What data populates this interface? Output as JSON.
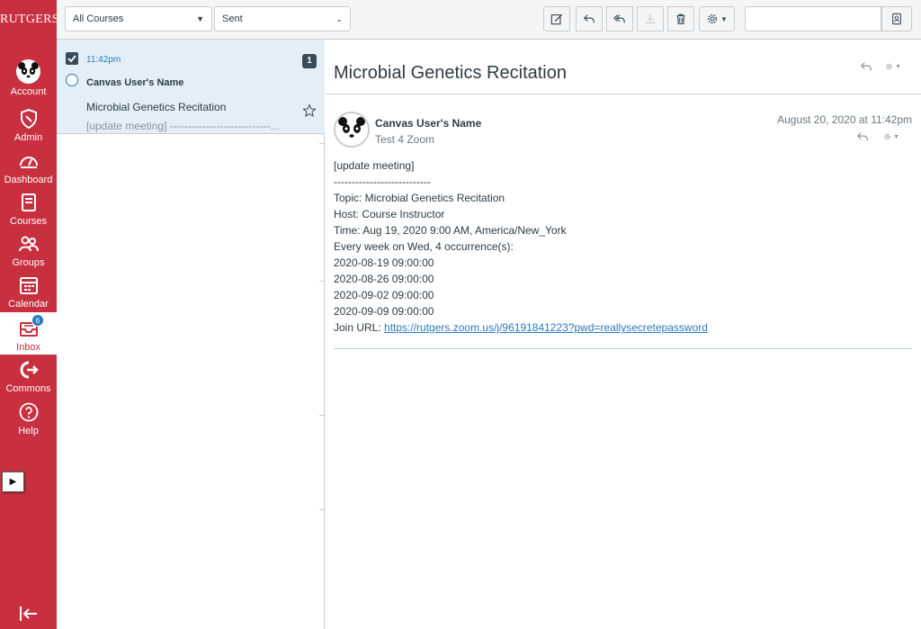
{
  "nav": {
    "logo": "RUTGERS",
    "items": [
      {
        "label": "Account",
        "icon": "account-avatar"
      },
      {
        "label": "Admin",
        "icon": "shield-icon"
      },
      {
        "label": "Dashboard",
        "icon": "dashboard-icon"
      },
      {
        "label": "Courses",
        "icon": "courses-icon"
      },
      {
        "label": "Groups",
        "icon": "groups-icon"
      },
      {
        "label": "Calendar",
        "icon": "calendar-icon"
      },
      {
        "label": "Inbox",
        "icon": "inbox-icon",
        "badge": "6"
      },
      {
        "label": "Commons",
        "icon": "commons-icon"
      },
      {
        "label": "Help",
        "icon": "help-icon"
      }
    ],
    "expand_glyph": "▶"
  },
  "toolbar": {
    "course_filter": "All Courses",
    "mailbox": "Sent",
    "search_placeholder": ""
  },
  "list": {
    "items": [
      {
        "time": "11:42pm",
        "count": "1",
        "sender": "Canvas User's Name",
        "subject": "Microbial Genetics Recitation",
        "preview": "[update meeting] ----------------------------..."
      }
    ]
  },
  "message": {
    "subject": "Microbial Genetics Recitation",
    "from": "Canvas User's Name",
    "to": "Test 4 Zoom",
    "date": "August 20, 2020 at 11:42pm",
    "body_lines": [
      "[update meeting]",
      "---------------------------",
      "Topic: Microbial Genetics Recitation",
      "Host: Course Instructor",
      "Time: Aug 19, 2020 9:00 AM, America/New_York",
      "Every week on Wed, 4 occurrence(s):",
      "2020-08-19 09:00:00",
      "2020-08-26 09:00:00",
      "2020-09-02 09:00:00",
      "2020-09-09 09:00:00"
    ],
    "join_label": "Join URL: ",
    "join_url": "https://rutgers.zoom.us/j/96191841223?pwd=reallysecretepassword"
  },
  "colors": {
    "brand": "#c8303f",
    "link": "#2b7abc",
    "selected_row": "#e4eef6"
  }
}
